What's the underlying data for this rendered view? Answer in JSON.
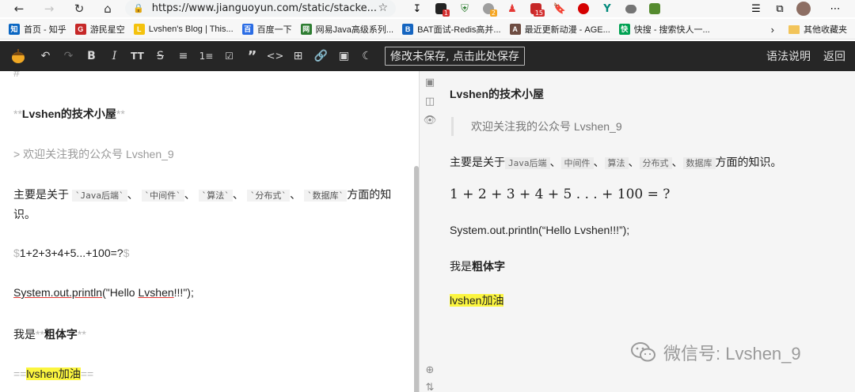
{
  "browser": {
    "url": "https://www.jianguoyun.com/static/stacke...",
    "extensions": [
      {
        "icon": "download-icon",
        "badge": ""
      },
      {
        "icon": "extension-black-icon",
        "badge": "1"
      },
      {
        "icon": "shield-icon",
        "badge": ""
      },
      {
        "icon": "extension-gray-icon",
        "badge": "2"
      },
      {
        "icon": "people-icon",
        "badge": ""
      },
      {
        "icon": "red-square-icon",
        "badge": "15"
      },
      {
        "icon": "bookmark-icon",
        "badge": ""
      },
      {
        "icon": "red-circle-icon",
        "badge": ""
      },
      {
        "icon": "green-y-icon",
        "badge": ""
      },
      {
        "icon": "cloud-icon",
        "badge": ""
      },
      {
        "icon": "green-extension-icon",
        "badge": ""
      }
    ]
  },
  "bookmarks": [
    {
      "label": "首页 - 知乎",
      "icon": "zhihu-icon",
      "color": "#0a66c2",
      "glyph": "知"
    },
    {
      "label": "游民星空",
      "icon": "gamersky-icon",
      "color": "#c62828",
      "glyph": "G"
    },
    {
      "label": "Lvshen's Blog | This...",
      "icon": "blog-icon",
      "color": "#f4c20d",
      "glyph": "L"
    },
    {
      "label": "百度一下",
      "icon": "baidu-icon",
      "color": "#2b6de5",
      "glyph": "百"
    },
    {
      "label": "网易Java高级系列...",
      "icon": "netease-icon",
      "color": "#2e7d32",
      "glyph": "网"
    },
    {
      "label": "BAT面试-Redis高并...",
      "icon": "bat-icon",
      "color": "#1565c0",
      "glyph": "B"
    },
    {
      "label": "最近更新动漫 - AGE...",
      "icon": "age-icon",
      "color": "#6d4c41",
      "glyph": "A"
    },
    {
      "label": "快搜 - 搜索快人一...",
      "icon": "kuaisou-icon",
      "color": "#00a152",
      "glyph": "快"
    }
  ],
  "bookmarks_other": "其他收藏夹",
  "editor_toolbar": {
    "save_notice": "修改未保存, 点击此处保存",
    "help": "语法说明",
    "back": "返回"
  },
  "source": {
    "heading_mark": "#",
    "title_mark_open": "**",
    "title": "Lvshen的技术小屋",
    "title_mark_close": "**",
    "quote_mark": "> ",
    "quote": "欢迎关注我的公众号 Lvshen_9",
    "para_prefix": "主要是关于",
    "tags": [
      "`Java后端`",
      "`中间件`",
      "`算法`",
      "`分布式`",
      "`数据库`"
    ],
    "sep": "、",
    "para_suffix": "方面的知",
    "para_wrap": "识。",
    "math_mark": "$",
    "math": "1+2+3+4+5...+100=?",
    "code_pre": "System.out.println",
    "code_mid": "(\"Hello ",
    "code_name": "Lvshen",
    "code_post": "!!!\");",
    "bold_prefix": "我是",
    "bold_mark": "**",
    "bold_text": "粗体字",
    "hl_mark": "==",
    "hl_text": "lvshen加油"
  },
  "preview": {
    "title": "Lvshen的技术小屋",
    "quote": "欢迎关注我的公众号 Lvshen_9",
    "para_prefix": "主要是关于",
    "tags": [
      "Java后端",
      "中间件",
      "算法",
      "分布式",
      "数据库"
    ],
    "sep": "、",
    "para_suffix": "方面的知识。",
    "math": "1 + 2 + 3 + 4 + 5 . . . + 100 = ?",
    "code": "System.out.println(“Hello Lvshen!!!”);",
    "bold_prefix": "我是",
    "bold_text": "粗体字",
    "hl_text": "lvshen加油"
  },
  "watermark": "微信号: Lvshen_9"
}
